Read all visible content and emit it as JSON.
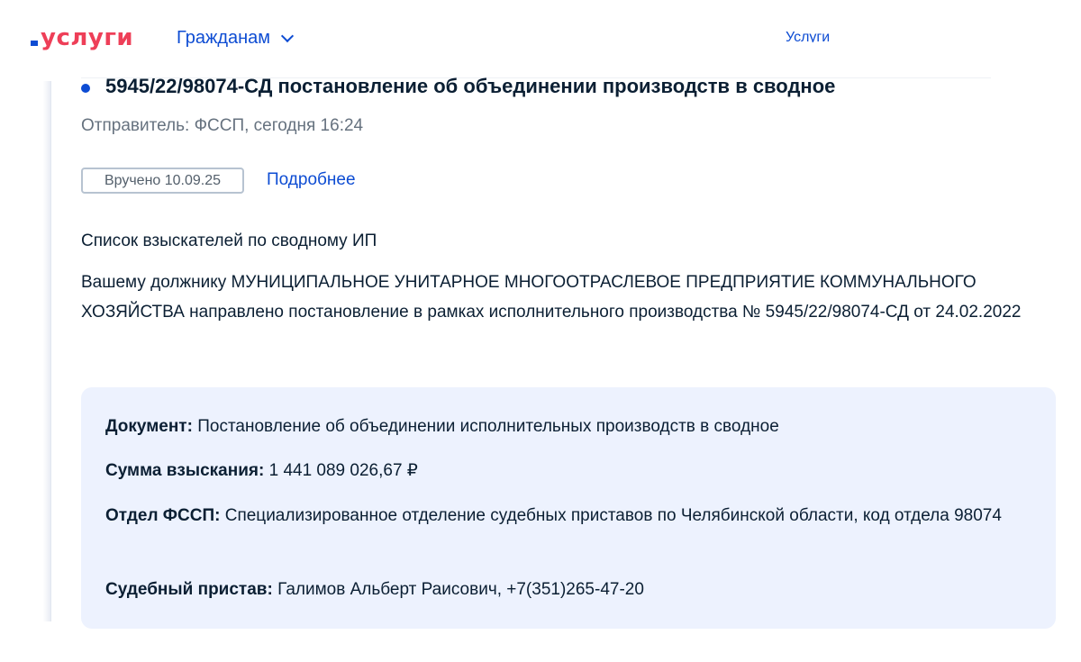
{
  "header": {
    "logo_text": "услуги",
    "nav_citizens": "Гражданам",
    "nav_services": "Услуги"
  },
  "notification": {
    "title": "5945/22/98074-СД постановление об объединении производств в сводное",
    "sender": "Отправитель: ФССП, сегодня 16:24",
    "status_badge": "Вручено 10.09.25",
    "more_link": "Подробнее",
    "list_title": "Список взыскателей по сводному ИП",
    "message": "Вашему должнику МУНИЦИПАЛЬНОЕ УНИТАРНОЕ МНОГООТРАСЛЕВОЕ ПРЕДПРИЯТИЕ КОММУНАЛЬНОГО ХОЗЯЙСТВА направлено постановление в рамках исполнительного производства № 5945/22/98074-СД от 24.02.2022"
  },
  "details": {
    "document_label": "Документ:",
    "document_value": "Постановление об объединении исполнительных производств в сводное",
    "amount_label": "Сумма взыскания:",
    "amount_value": "1 441 089 026,67 ₽",
    "department_label": "Отдел ФССП:",
    "department_value": "Специализированное отделение судебных приставов по Челябинской области, код отдела 98074",
    "bailiff_label": "Судебный пристав:",
    "bailiff_value": "Галимов Альберт Раисович, +7(351)265-47-20"
  },
  "colors": {
    "brand_blue": "#0d4cd3",
    "brand_red": "#ee3f58",
    "info_box_bg": "#edf2fe"
  }
}
